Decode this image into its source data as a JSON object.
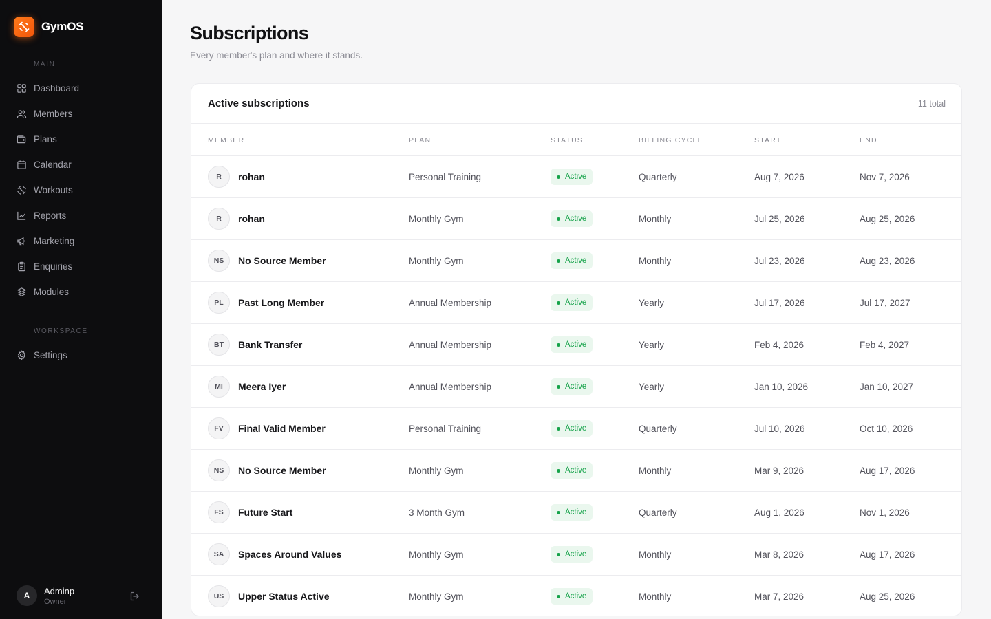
{
  "app": {
    "name": "GymOS",
    "accent": "#f2560b"
  },
  "sidebar": {
    "sections": [
      {
        "label": "MAIN",
        "items": [
          {
            "label": "Dashboard",
            "icon": "grid-icon"
          },
          {
            "label": "Members",
            "icon": "users-icon"
          },
          {
            "label": "Plans",
            "icon": "wallet-icon"
          },
          {
            "label": "Calendar",
            "icon": "calendar-icon"
          },
          {
            "label": "Workouts",
            "icon": "dumbbell-icon"
          },
          {
            "label": "Reports",
            "icon": "chart-line-icon"
          },
          {
            "label": "Marketing",
            "icon": "megaphone-icon"
          },
          {
            "label": "Enquiries",
            "icon": "clipboard-icon"
          },
          {
            "label": "Modules",
            "icon": "layers-icon"
          }
        ]
      },
      {
        "label": "WORKSPACE",
        "items": [
          {
            "label": "Settings",
            "icon": "gear-icon"
          }
        ]
      }
    ],
    "user": {
      "initial": "A",
      "name": "Adminp",
      "role": "Owner"
    }
  },
  "page": {
    "title": "Subscriptions",
    "subtitle": "Every member's plan and where it stands."
  },
  "card": {
    "title": "Active subscriptions",
    "count": "11 total",
    "columns": [
      "MEMBER",
      "PLAN",
      "STATUS",
      "BILLING CYCLE",
      "START",
      "END"
    ],
    "rows": [
      {
        "initials": "R",
        "member": "rohan",
        "plan": "Personal Training",
        "status": "Active",
        "cycle": "Quarterly",
        "start": "Aug 7, 2026",
        "end": "Nov 7, 2026"
      },
      {
        "initials": "R",
        "member": "rohan",
        "plan": "Monthly Gym",
        "status": "Active",
        "cycle": "Monthly",
        "start": "Jul 25, 2026",
        "end": "Aug 25, 2026"
      },
      {
        "initials": "NS",
        "member": "No Source Member",
        "plan": "Monthly Gym",
        "status": "Active",
        "cycle": "Monthly",
        "start": "Jul 23, 2026",
        "end": "Aug 23, 2026"
      },
      {
        "initials": "PL",
        "member": "Past Long Member",
        "plan": "Annual Membership",
        "status": "Active",
        "cycle": "Yearly",
        "start": "Jul 17, 2026",
        "end": "Jul 17, 2027"
      },
      {
        "initials": "BT",
        "member": "Bank Transfer",
        "plan": "Annual Membership",
        "status": "Active",
        "cycle": "Yearly",
        "start": "Feb 4, 2026",
        "end": "Feb 4, 2027"
      },
      {
        "initials": "MI",
        "member": "Meera Iyer",
        "plan": "Annual Membership",
        "status": "Active",
        "cycle": "Yearly",
        "start": "Jan 10, 2026",
        "end": "Jan 10, 2027"
      },
      {
        "initials": "FV",
        "member": "Final Valid Member",
        "plan": "Personal Training",
        "status": "Active",
        "cycle": "Quarterly",
        "start": "Jul 10, 2026",
        "end": "Oct 10, 2026"
      },
      {
        "initials": "NS",
        "member": "No Source Member",
        "plan": "Monthly Gym",
        "status": "Active",
        "cycle": "Monthly",
        "start": "Mar 9, 2026",
        "end": "Aug 17, 2026"
      },
      {
        "initials": "FS",
        "member": "Future Start",
        "plan": "3 Month Gym",
        "status": "Active",
        "cycle": "Quarterly",
        "start": "Aug 1, 2026",
        "end": "Nov 1, 2026"
      },
      {
        "initials": "SA",
        "member": "Spaces Around Values",
        "plan": "Monthly Gym",
        "status": "Active",
        "cycle": "Monthly",
        "start": "Mar 8, 2026",
        "end": "Aug 17, 2026"
      },
      {
        "initials": "US",
        "member": "Upper Status Active",
        "plan": "Monthly Gym",
        "status": "Active",
        "cycle": "Monthly",
        "start": "Mar 7, 2026",
        "end": "Aug 25, 2026"
      }
    ]
  }
}
